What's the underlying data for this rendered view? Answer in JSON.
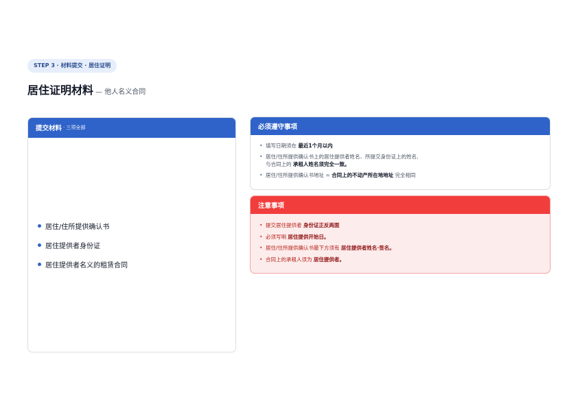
{
  "header": {
    "step_label": "STEP 3 · 材料提交 · 居住证明",
    "title": "居住证明材料",
    "subtitle": "— 他人名义合同"
  },
  "materials": {
    "title": "提交材料",
    "note": "· 三项全部",
    "items": [
      {
        "label": "居住/住所提供确认书"
      },
      {
        "label": "居住提供者身份证"
      },
      {
        "label": "居住提供者名义的租赁合同"
      }
    ]
  },
  "rules": {
    "title": "必须遵守事项",
    "items": [
      {
        "pre": "填写日期须在 ",
        "bold": "最近1个月以内",
        "post": ""
      },
      {
        "pre": "居住/住所提供确认书上的居住提供者姓名、所提交身份证上的姓名,",
        "line2_pre": "与合同上的 ",
        "bold": "承租人姓名须完全一致。",
        "post": ""
      },
      {
        "pre": "居住/住所提供确认书地址 = ",
        "bold": "合同上的不动产所在地地址",
        "post": " 完全相同"
      }
    ]
  },
  "notices": {
    "title": "注意事项",
    "items": [
      {
        "pre": "提交居住提供者 ",
        "bold": "身份证正反两面",
        "post": ""
      },
      {
        "pre": "必须写明 ",
        "bold": "居住提供开始日。",
        "post": ""
      },
      {
        "pre": "居住/住所提供确认书最下方须有 ",
        "bold": "居住提供者姓名·签名。",
        "post": ""
      },
      {
        "pre": "合同上的承租人须为 ",
        "bold": "居住提供者。",
        "post": ""
      }
    ]
  },
  "colors": {
    "primary": "#2f63c9",
    "danger": "#f23d3d",
    "danger_bg": "#fdecec"
  }
}
